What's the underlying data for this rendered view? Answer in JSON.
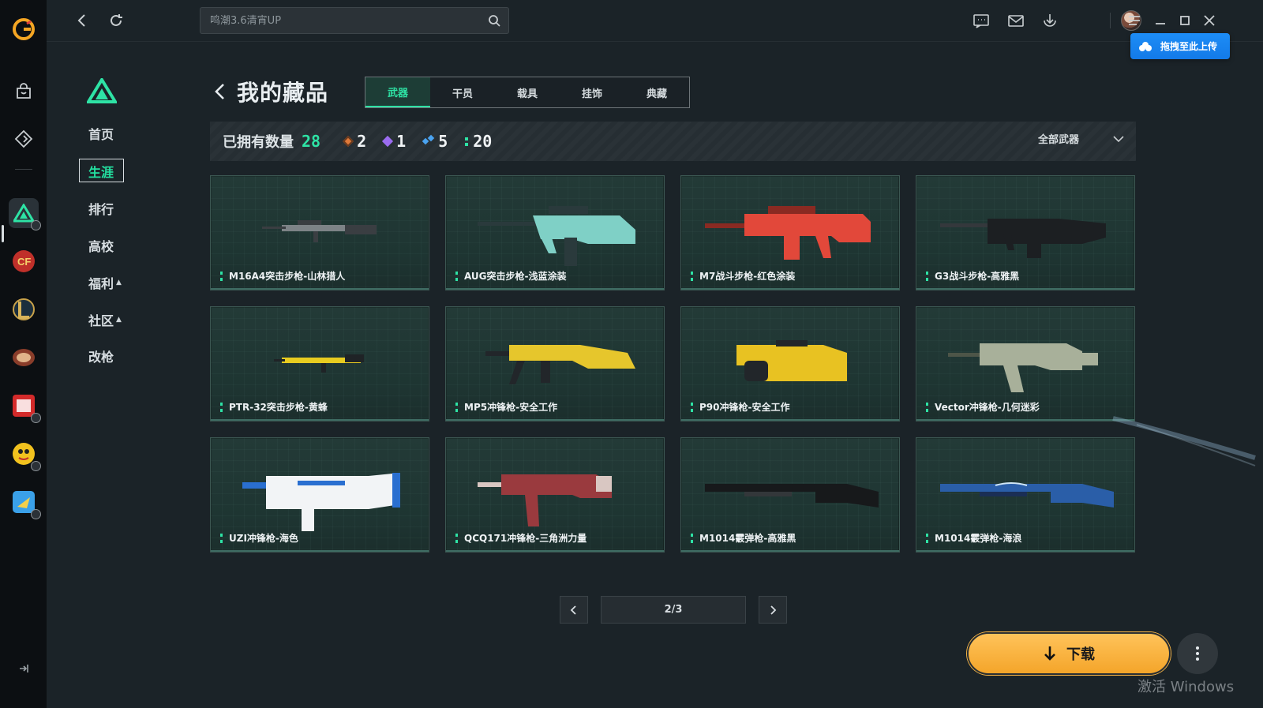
{
  "topbar": {
    "search_placeholder": "鸣潮3.6清宵UP",
    "upload_label": "拖拽至此上传"
  },
  "subnav": {
    "items": [
      {
        "label": "首页"
      },
      {
        "label": "生涯",
        "active": true
      },
      {
        "label": "排行"
      },
      {
        "label": "高校"
      },
      {
        "label": "福利",
        "expandable": true
      },
      {
        "label": "社区",
        "expandable": true
      },
      {
        "label": "改枪"
      }
    ]
  },
  "main": {
    "title": "我的藏品",
    "tabs": [
      {
        "label": "武器",
        "active": true
      },
      {
        "label": "干员"
      },
      {
        "label": "载具"
      },
      {
        "label": "挂饰"
      },
      {
        "label": "典藏"
      }
    ],
    "stats": {
      "owned_label": "已拥有数量",
      "owned_total": "28",
      "rarity_counts": [
        {
          "value": "2",
          "color": "#e07a3a"
        },
        {
          "value": "1",
          "color": "#9b6cf0"
        },
        {
          "value": "5",
          "color": "#4aa3f0"
        },
        {
          "value": "20",
          "color": "#2ee3a5"
        }
      ],
      "filter_label": "全部武器"
    },
    "items": [
      {
        "name": "M16A4突击步枪-山林猎人",
        "main": "#7d8387",
        "accent": "#3a3e42"
      },
      {
        "name": "AUG突击步枪-浅蓝涂装",
        "main": "#7fd0c6",
        "accent": "#2a3a3c"
      },
      {
        "name": "M7战斗步枪-红色涂装",
        "main": "#e2483a",
        "accent": "#8a2a22"
      },
      {
        "name": "G3战斗步枪-高雅黑",
        "main": "#1c1f22",
        "accent": "#34383c"
      },
      {
        "name": "PTR-32突击步枪-黄蜂",
        "main": "#e8cc20",
        "accent": "#1f2326"
      },
      {
        "name": "MP5冲锋枪-安全工作",
        "main": "#e6c62c",
        "accent": "#22262a"
      },
      {
        "name": "P90冲锋枪-安全工作",
        "main": "#e8c222",
        "accent": "#22262a"
      },
      {
        "name": "Vector冲锋枪-几何迷彩",
        "main": "#a8b09a",
        "accent": "#4d5548"
      },
      {
        "name": "UZI冲锋枪-海色",
        "main": "#f2f4f6",
        "accent": "#2a6fd0"
      },
      {
        "name": "QCQ171冲锋枪-三角洲力量",
        "main": "#9a3a3e",
        "accent": "#d9c7c2"
      },
      {
        "name": "M1014霰弹枪-高雅黑",
        "main": "#17191b",
        "accent": "#33373a"
      },
      {
        "name": "M1014霰弹枪-海浪",
        "main": "#2a5ea8",
        "accent": "#1a2e55"
      }
    ],
    "pager": {
      "label": "2/3"
    },
    "download_label": "下载"
  },
  "watermark": "激活 Windows"
}
